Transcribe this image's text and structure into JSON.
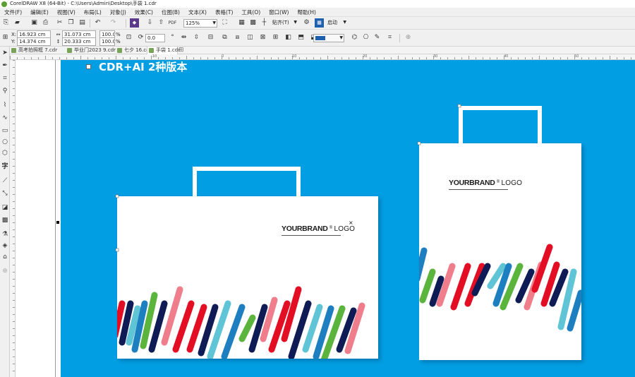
{
  "window": {
    "title": "CorelDRAW X8 (64-Bit) - C:\\Users\\Admin\\Desktop\\手袋 1.cdr"
  },
  "menu": [
    "文件(F)",
    "编辑(E)",
    "视图(V)",
    "布局(L)",
    "对象(J)",
    "效果(C)",
    "位图(B)",
    "文本(X)",
    "表格(T)",
    "工具(O)",
    "窗口(W)",
    "帮助(H)"
  ],
  "toolbar": {
    "zoom": "125%",
    "snap_label": "贴齐(T)",
    "launch_label": "启动"
  },
  "property_bar": {
    "x_label": "X:",
    "x_value": "16.923 cm",
    "y_label": "Y:",
    "y_value": "14.374 cm",
    "width_value": "31.073 cm",
    "height_value": "20.333 cm",
    "scale_x": "100.0",
    "scale_y": "100.0",
    "percent_sign": "%",
    "angle": "0.0"
  },
  "tabs": [
    {
      "label": "高考拍照框 7.cdr",
      "active": false
    },
    {
      "label": "毕业门2023 9.cdr",
      "active": false
    },
    {
      "label": "七夕 16.cdr",
      "active": false
    },
    {
      "label": "手袋 1.cdr",
      "active": true
    }
  ],
  "ruler_numbers": [
    "-10",
    "0",
    "10",
    "20",
    "30",
    "40",
    "50",
    "60",
    "70"
  ],
  "canvas": {
    "banner_text": "CDR+AI 2种版本",
    "background_color": "#029ee3",
    "bag_logo_brand": "YOURBRAND",
    "bag_logo_text": "LOGO",
    "bag_logo_dot": "®"
  },
  "colors": {
    "stripe_navy": "#0e1b55",
    "stripe_red": "#e30d24",
    "stripe_green": "#5bb53d",
    "stripe_blue": "#1d7fc0",
    "stripe_pink": "#ef7d8c",
    "stripe_teal": "#5ec4d6"
  }
}
